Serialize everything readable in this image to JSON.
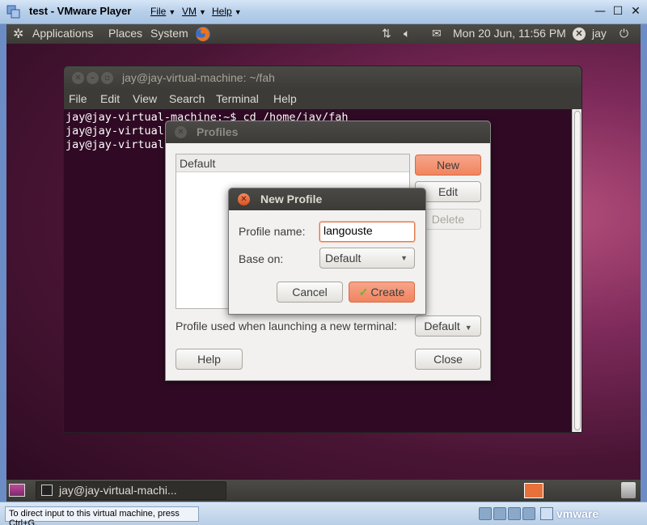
{
  "vmware": {
    "title": "test - VMware Player",
    "menus": [
      {
        "label": "File"
      },
      {
        "label": "VM"
      },
      {
        "label": "Help"
      }
    ],
    "status_hint": "To direct input to this virtual machine, press Ctrl+G.",
    "logo_text": "vmware"
  },
  "top_panel": {
    "applications": "Applications",
    "places": "Places",
    "system": "System",
    "clock": "Mon 20 Jun, 11:56 PM",
    "user": "jay"
  },
  "terminal": {
    "title": "jay@jay-virtual-machine: ~/fah",
    "menus": [
      "File",
      "Edit",
      "View",
      "Search",
      "Terminal",
      "Help"
    ],
    "lines": [
      "jay@jay-virtual-machine:~$ cd /home/jay/fah",
      "jay@jay-virtual-",
      "jay@jay-virtual-"
    ]
  },
  "profiles": {
    "title": "Profiles",
    "list_items": [
      "Default"
    ],
    "new_label": "New",
    "edit_label": "Edit",
    "delete_label": "Delete",
    "used_label": "Profile used when launching a new terminal:",
    "used_value": "Default",
    "help_label": "Help",
    "close_label": "Close"
  },
  "new_profile": {
    "title": "New Profile",
    "name_label": "Profile name:",
    "name_value": "langouste",
    "base_label": "Base on:",
    "base_value": "Default",
    "cancel_label": "Cancel",
    "create_label": "Create"
  },
  "bottom_panel": {
    "task_label": "jay@jay-virtual-machi..."
  }
}
